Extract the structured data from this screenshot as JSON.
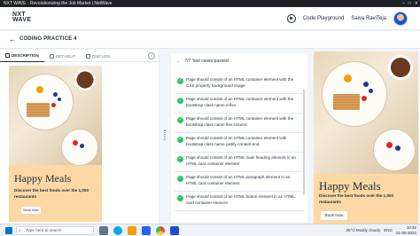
{
  "browser": {
    "tab_title": "NXT WAVE - Revolutionizing the Job Market | NxtWave",
    "controls": [
      "–",
      "□",
      "✕"
    ]
  },
  "header": {
    "logo_line1": "NXT",
    "logo_line2": "WAVE",
    "playground_label": "Code Playground",
    "user_name": "Saiva RaviTeja"
  },
  "subheader": {
    "title": "CODING PRACTICE 4"
  },
  "left_panel": {
    "tabs": [
      {
        "label": "DESCRIPTION",
        "icon": "description-icon"
      },
      {
        "label": "GET HELP",
        "icon": "help-icon"
      },
      {
        "label": "DISCUSS",
        "icon": "discuss-icon"
      }
    ],
    "collapse_label": "‹"
  },
  "card": {
    "heading": "Happy Meals",
    "description": "Discover the best foods over the 1,000 restaurants",
    "button_label": "Book Now",
    "colors": {
      "background": "#fcd9a4",
      "text": "#1e293b"
    }
  },
  "results": {
    "summary": "7/7 Test cases passed",
    "items": [
      "Page should consist of an HTML container element with the CSS property background image",
      "Page should consist of an HTML container element with the bootstrap class name d-flex",
      "Page should consist of an HTML container element with the bootstrap class name flex-column",
      "Page should consist of an HTML container element with bootstrap class name justify-content-end",
      "Page should consist of an HTML main heading element in an HTML card container element",
      "Page should consist of an HTML paragraph element in an HTML card container element",
      "Page should consist of an HTML button element in an HTML card container element"
    ],
    "status_color": "#22c55e"
  },
  "taskbar": {
    "search_placeholder": "Type here to search",
    "weather": "26°C  Mostly cloudy",
    "language": "ENG",
    "time": "10:32",
    "date": "01-05-2023"
  }
}
